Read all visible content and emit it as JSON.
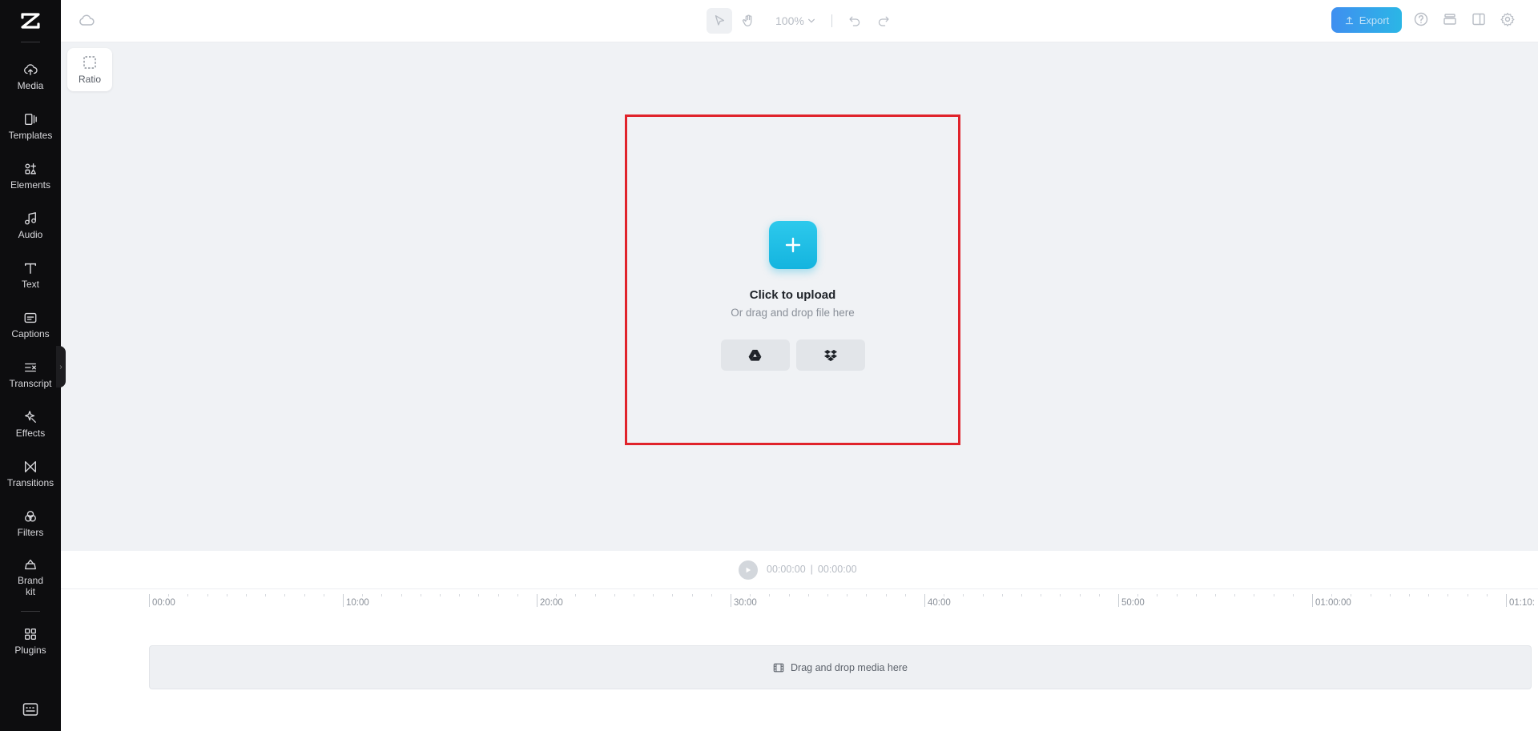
{
  "sidebar": {
    "items": [
      {
        "label": "Media",
        "icon": "cloud-upload-icon"
      },
      {
        "label": "Templates",
        "icon": "templates-icon"
      },
      {
        "label": "Elements",
        "icon": "elements-icon"
      },
      {
        "label": "Audio",
        "icon": "music-note-icon"
      },
      {
        "label": "Text",
        "icon": "text-icon"
      },
      {
        "label": "Captions",
        "icon": "captions-icon"
      },
      {
        "label": "Transcript",
        "icon": "transcript-icon"
      },
      {
        "label": "Effects",
        "icon": "effects-icon"
      },
      {
        "label": "Transitions",
        "icon": "transitions-icon"
      },
      {
        "label": "Filters",
        "icon": "filters-icon"
      },
      {
        "label": "Brand kit",
        "icon": "brand-kit-icon"
      },
      {
        "label": "Plugins",
        "icon": "plugins-icon"
      }
    ]
  },
  "topbar": {
    "zoom": "100%",
    "export_label": "Export"
  },
  "ratio": {
    "label": "Ratio"
  },
  "upload": {
    "title": "Click to upload",
    "subtitle": "Or drag and drop file here"
  },
  "player": {
    "current_time": "00:00:00",
    "separator": "|",
    "total_time": "00:00:00"
  },
  "timeline": {
    "ticks": [
      "00:00",
      "10:00",
      "20:00",
      "30:00",
      "40:00",
      "50:00",
      "01:00:00",
      "01:10:"
    ],
    "drop_label": "Drag and drop media here"
  },
  "colors": {
    "sidebar_bg": "#0d0d0f",
    "accent": "#14b4df",
    "highlight_border": "#e0232b"
  }
}
